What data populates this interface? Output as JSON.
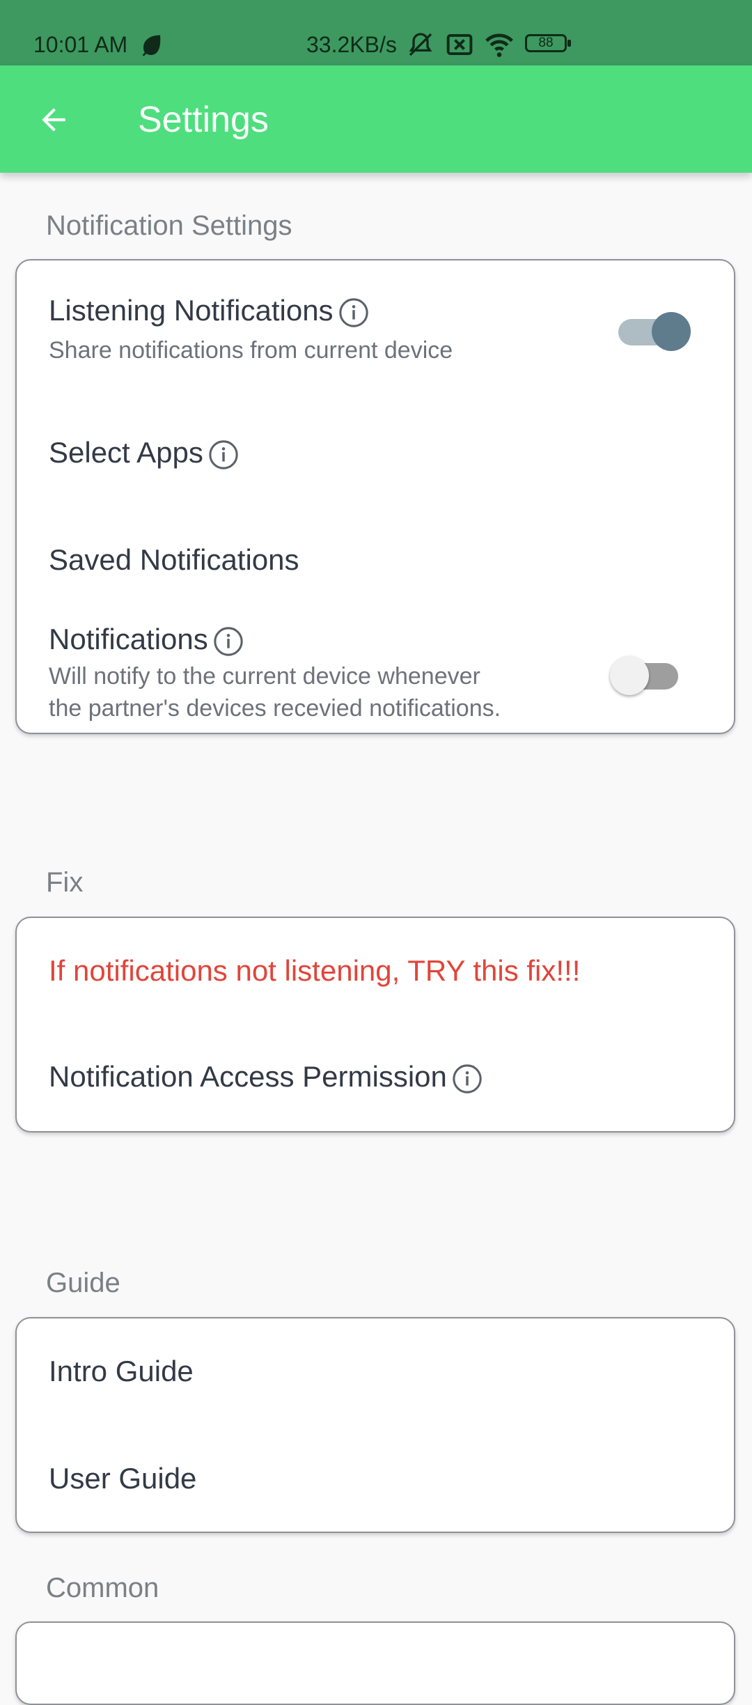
{
  "status_bar": {
    "time": "10:01 AM",
    "network_speed": "33.2KB/s",
    "battery": "88",
    "icons": [
      "leaf-icon",
      "mute-icon",
      "sim-off-icon",
      "wifi-icon",
      "battery-icon"
    ]
  },
  "app_bar": {
    "title": "Settings",
    "back_icon": "arrow-left-icon"
  },
  "sections": {
    "notification": {
      "title": "Notification Settings",
      "listening": {
        "label": "Listening Notifications",
        "subtitle": "Share notifications from current device",
        "enabled": true
      },
      "select_apps": {
        "label": "Select Apps"
      },
      "saved": {
        "label": "Saved Notifications"
      },
      "notifications": {
        "label": "Notifications",
        "subtitle_line1": "Will notify to the current device whenever",
        "subtitle_line2": "the partner's devices recevied notifications.",
        "enabled": false
      }
    },
    "fix": {
      "title": "Fix",
      "fix_link": {
        "label": "If notifications not listening, TRY this fix!!!",
        "color": "#e0453a"
      },
      "access_permission": {
        "label": "Notification Access Permission"
      }
    },
    "guide": {
      "title": "Guide",
      "intro": {
        "label": "Intro Guide"
      },
      "user": {
        "label": "User Guide"
      }
    },
    "common": {
      "title": "Common"
    }
  },
  "colors": {
    "status_bar": "#3d995f",
    "app_bar": "#4ede7e",
    "toggle_on_knob": "#5f7c8d",
    "toggle_on_track": "#aebcc3",
    "toggle_off_track": "#9e9e9e"
  }
}
